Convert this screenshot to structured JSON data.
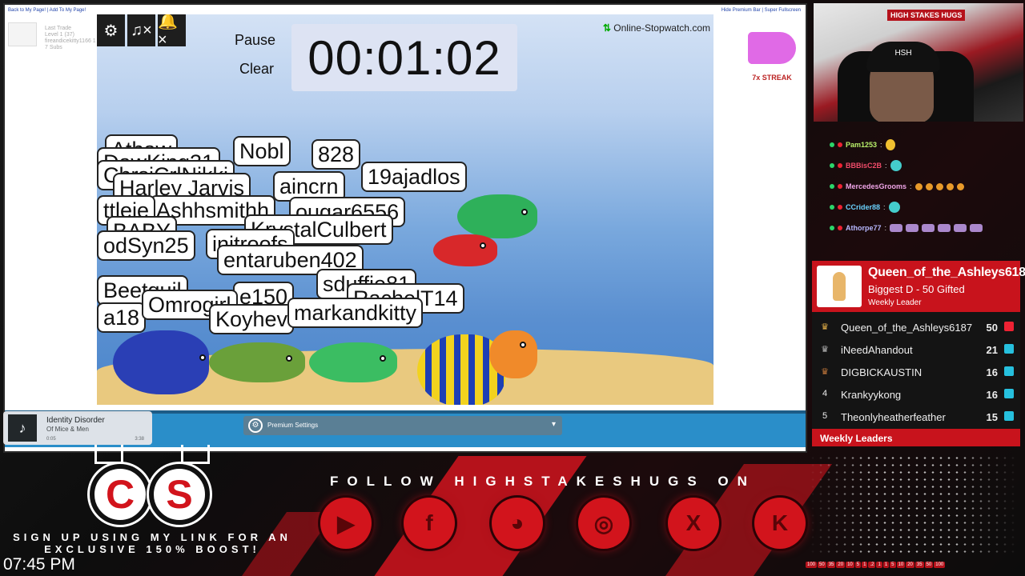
{
  "browser": {
    "top_links": "Back to My Page! | Add To My Page!",
    "top_right": "Hide Premium Bar | Super Fullscreen",
    "user_stats": [
      "Last Trade",
      "Level 1 (37)",
      "fireandicekitty1166 1",
      "7 Subs"
    ]
  },
  "stopwatch": {
    "pause_label": "Pause",
    "clear_label": "Clear",
    "time": "00:01:02",
    "brand": "Online-Stopwatch.com",
    "icons": [
      "gear-icon",
      "music-mute-icon",
      "bell-mute-icon"
    ],
    "icon_glyphs": [
      "⚙",
      "♫×",
      "🔔×"
    ]
  },
  "streak": {
    "label": "7x STREAK"
  },
  "bubbles": [
    "Athaw",
    "DawKing31",
    "Nobl",
    "828",
    "ChrsiCrlNikki",
    "aincrn",
    "19ajadlos",
    "Harley Jarvis",
    "Ashhsmithh",
    "ougar6556",
    "KrystalCulbert",
    "ttleje",
    "BABY",
    "odSyn25",
    "initroofs",
    "entaruben402",
    "sduffie81",
    "Beetquil",
    "e150",
    "RachelT14",
    "a18",
    "Omrogirl",
    "Koyhev",
    "markandkitty"
  ],
  "music": {
    "title": "Identity Disorder",
    "artist": "Of Mice & Men",
    "elapsed": "0:05",
    "duration": "3:38"
  },
  "premium": {
    "label": "Premium Settings"
  },
  "chat": [
    {
      "name": "Pam1253",
      "color": "#b8f06a",
      "sep": ":",
      "emotes": [
        "e"
      ]
    },
    {
      "name": "BBBisC2B",
      "color": "#f04c6a",
      "sep": ":",
      "emotes": [
        "t"
      ]
    },
    {
      "name": "MercedesGrooms",
      "color": "#f0a5e8",
      "sep": ":",
      "emotes": [
        "o",
        "o",
        "o",
        "o",
        "o"
      ]
    },
    {
      "name": "CCrider88",
      "color": "#6ad2ff",
      "sep": ":",
      "emotes": [
        "t"
      ]
    },
    {
      "name": "Athorpe77",
      "color": "#b8b8ff",
      "sep": ":",
      "emotes": [
        "p",
        "p",
        "p",
        "p",
        "p",
        "p"
      ]
    }
  ],
  "leaderboard": {
    "top_name": "Queen_of_the_Ashleys6187",
    "top_sub": "Biggest D - 50 Gifted",
    "top_sub2": "Weekly Leader",
    "rows": [
      {
        "rank": "♛",
        "name": "Queen_of_the_Ashleys6187",
        "count": "50"
      },
      {
        "rank": "♛",
        "name": "iNeedAhandout",
        "count": "21"
      },
      {
        "rank": "♛",
        "name": "DIGBICKAUSTIN",
        "count": "16"
      },
      {
        "rank": "4",
        "name": "Krankyykong",
        "count": "16"
      },
      {
        "rank": "5",
        "name": "Theonlyheatherfeather",
        "count": "15"
      }
    ],
    "footer": "Weekly Leaders"
  },
  "overlay": {
    "follow": "FOLLOW HIGHSTAKESHUGS ON",
    "cs_left": "C",
    "cs_right": "S",
    "signup": "SIGN UP USING MY LINK FOR AN EXCLUSIVE 150% BOOST!",
    "clock": "07:45 PM",
    "socials": [
      "youtube-icon",
      "facebook-icon",
      "discord-icon",
      "instagram-icon",
      "x-icon",
      "kick-icon"
    ],
    "social_glyphs": [
      "▶",
      "f",
      "◕",
      "◎",
      "X",
      "K"
    ],
    "ticks": [
      "100",
      "50",
      "35",
      "20",
      "10",
      "5",
      "1",
      ".2",
      "1",
      "1",
      "5",
      "10",
      "20",
      "35",
      "50",
      "100"
    ]
  },
  "webcam": {
    "banner": "HIGH STAKES HUGS",
    "cap": "HSH"
  }
}
